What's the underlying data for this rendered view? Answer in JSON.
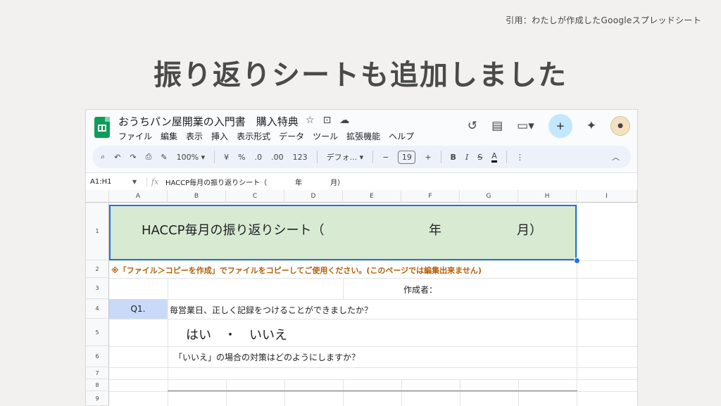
{
  "citation": "引用：わたしが作成したGoogleスプレッドシート",
  "slide_title": "振り返りシートも追加しました",
  "app": {
    "doc_title": "おうちパン屋開業の入門書　購入特典",
    "title_icons": [
      "star-icon",
      "folder-move-icon",
      "cloud-status-icon"
    ],
    "menu": [
      "ファイル",
      "編集",
      "表示",
      "挿入",
      "表示形式",
      "データ",
      "ツール",
      "拡張機能",
      "ヘルプ"
    ]
  },
  "toolbar": {
    "zoom": "100%",
    "currency": "¥",
    "percent": "%",
    "dec_less": ".0",
    "dec_more": ".00",
    "number_format": "123",
    "font_name": "デフォ...",
    "font_size": "19",
    "bold": "B",
    "italic": "I",
    "strike": "S",
    "text_color": "A"
  },
  "formula_bar": {
    "name_box": "A1:H1",
    "fx": "fx",
    "content": "HACCP毎月の振り返りシート（　　　　年　　　　月）"
  },
  "columns": [
    "A",
    "B",
    "C",
    "D",
    "E",
    "F",
    "G",
    "H",
    "I"
  ],
  "rows": [
    "1",
    "2",
    "3",
    "4",
    "5",
    "6",
    "7",
    "8",
    "9"
  ],
  "cells": {
    "header_title": "HACCP毎月の振り返りシート（",
    "header_year": "年",
    "header_month": "月",
    "header_paren": "）",
    "note": "※「ファイル＞コピーを作成」でファイルをコピーしてご使用ください。(このページでは編集出来ません)",
    "author_label": "作成者：",
    "q1_label": "Q1.",
    "q1_text": "毎営業日、正しく記録をつけることができましたか？",
    "answer": "はい　・　いいえ",
    "q1_followup": "「いいえ」の場合の対策はどのようにしますか？"
  },
  "colors": {
    "header_fill": "#d9ead3",
    "q_fill": "#c9daf8",
    "note_color": "#b45f06",
    "selection": "#1a73e8"
  }
}
